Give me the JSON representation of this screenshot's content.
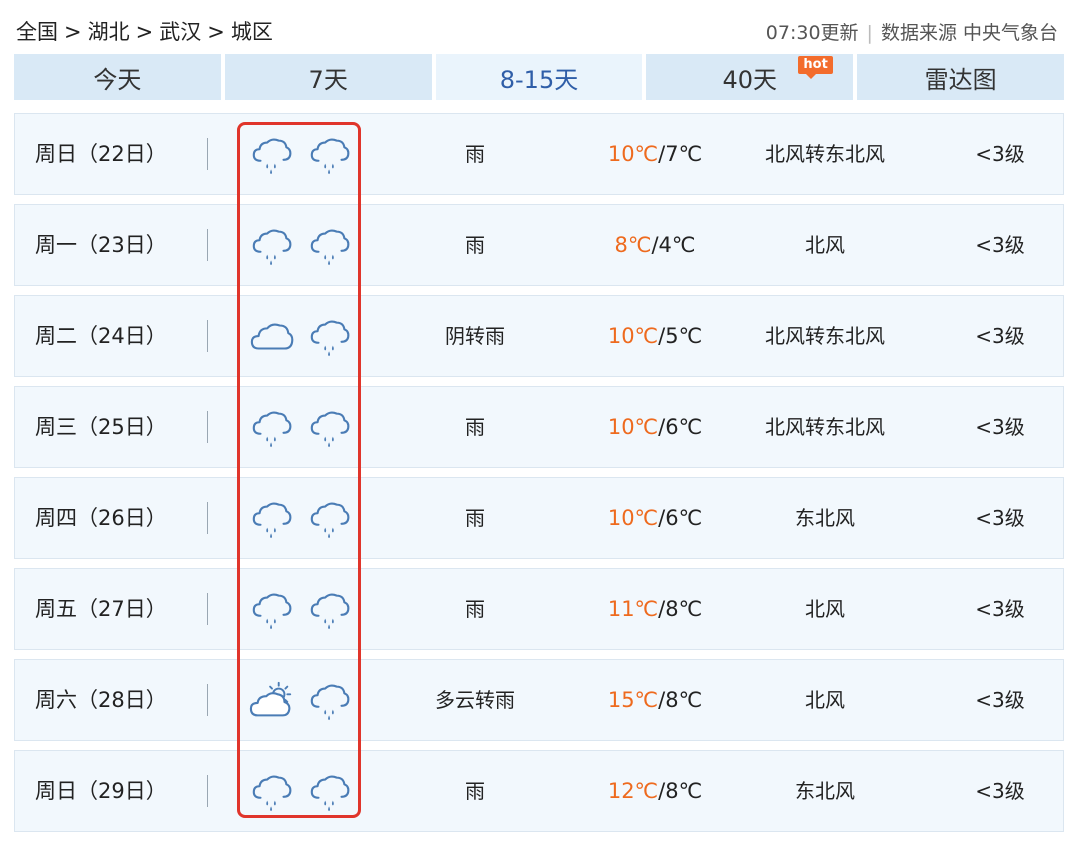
{
  "breadcrumb": {
    "items": [
      "全国",
      "湖北",
      "武汉",
      "城区"
    ],
    "separator": ">"
  },
  "update": {
    "time_text": "07:30更新",
    "source_text": "数据来源 中央气象台"
  },
  "tabs": [
    {
      "label": "今天",
      "active": false
    },
    {
      "label": "7天",
      "active": false
    },
    {
      "label": "8-15天",
      "active": true
    },
    {
      "label": "40天",
      "active": false,
      "badge": "hot"
    },
    {
      "label": "雷达图",
      "active": false
    }
  ],
  "forecast": [
    {
      "date": "周日（22日）",
      "icons": [
        "rain-cloud-icon",
        "rain-cloud-icon"
      ],
      "desc": "雨",
      "hi": "10℃",
      "lo": "/7℃",
      "wind": "北风转东北风",
      "level": "<3级"
    },
    {
      "date": "周一（23日）",
      "icons": [
        "rain-cloud-icon",
        "rain-cloud-icon"
      ],
      "desc": "雨",
      "hi": "8℃",
      "lo": "/4℃",
      "wind": "北风",
      "level": "<3级"
    },
    {
      "date": "周二（24日）",
      "icons": [
        "overcast-cloud-icon",
        "rain-cloud-icon"
      ],
      "desc": "阴转雨",
      "hi": "10℃",
      "lo": "/5℃",
      "wind": "北风转东北风",
      "level": "<3级"
    },
    {
      "date": "周三（25日）",
      "icons": [
        "rain-cloud-icon",
        "rain-cloud-icon"
      ],
      "desc": "雨",
      "hi": "10℃",
      "lo": "/6℃",
      "wind": "北风转东北风",
      "level": "<3级"
    },
    {
      "date": "周四（26日）",
      "icons": [
        "rain-cloud-icon",
        "rain-cloud-icon"
      ],
      "desc": "雨",
      "hi": "10℃",
      "lo": "/6℃",
      "wind": "东北风",
      "level": "<3级"
    },
    {
      "date": "周五（27日）",
      "icons": [
        "rain-cloud-icon",
        "rain-cloud-icon"
      ],
      "desc": "雨",
      "hi": "11℃",
      "lo": "/8℃",
      "wind": "北风",
      "level": "<3级"
    },
    {
      "date": "周六（28日）",
      "icons": [
        "partly-cloudy-sun-icon",
        "rain-cloud-icon"
      ],
      "desc": "多云转雨",
      "hi": "15℃",
      "lo": "/8℃",
      "wind": "北风",
      "level": "<3级"
    },
    {
      "date": "周日（29日）",
      "icons": [
        "rain-cloud-icon",
        "rain-cloud-icon"
      ],
      "desc": "雨",
      "hi": "12℃",
      "lo": "/8℃",
      "wind": "东北风",
      "level": "<3级"
    }
  ],
  "colors": {
    "accent_tab_text": "#2f5ea8",
    "high_temp": "#ee6a1e",
    "tab_bg": "#d9e9f6",
    "row_bg": "#f2f8fd",
    "highlight_border": "#e0352b",
    "icon_stroke": "#4a7cb5"
  }
}
